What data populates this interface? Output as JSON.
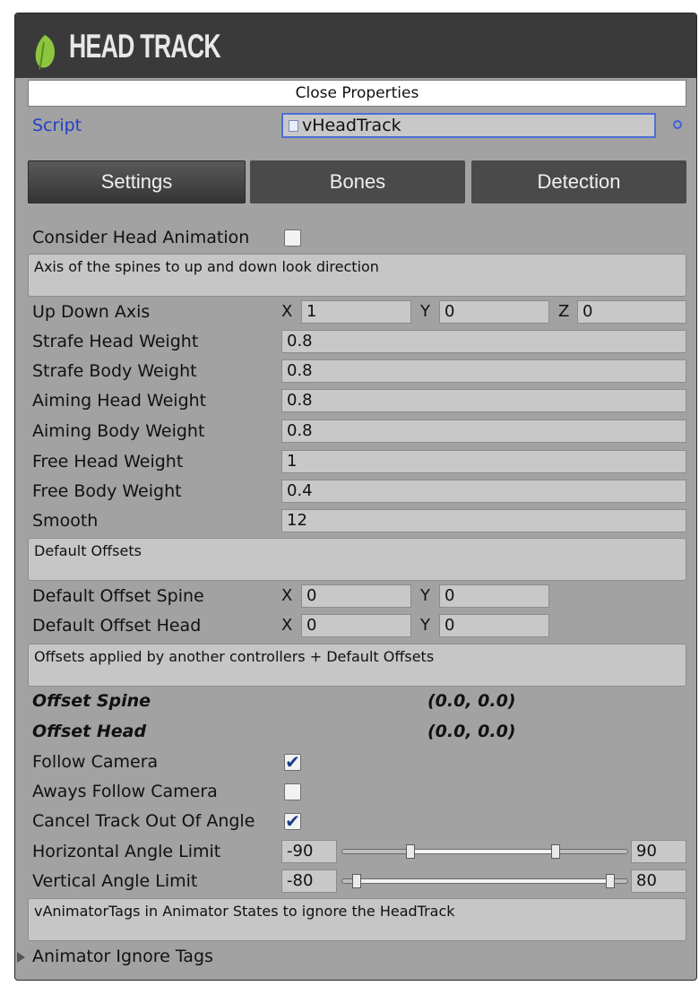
{
  "header": {
    "title": "HEAD TRACK",
    "logo_icon": "leaf-icon",
    "accent_color": "#8cc63f"
  },
  "close_properties_label": "Close Properties",
  "script": {
    "label": "Script",
    "value": "vHeadTrack"
  },
  "tabs": [
    {
      "label": "Settings",
      "active": true
    },
    {
      "label": "Bones",
      "active": false
    },
    {
      "label": "Detection",
      "active": false
    }
  ],
  "consider_head_animation": {
    "label": "Consider Head Animation",
    "checked": false
  },
  "help": {
    "axis": "Axis of the spines to up and down look direction",
    "default_offsets": "Default Offsets",
    "offsets_applied": "Offsets applied by another controllers + Default Offsets",
    "animator_tags": "vAnimatorTags in Animator States to ignore the HeadTrack"
  },
  "up_down_axis": {
    "label": "Up Down Axis",
    "x_letter": "X",
    "y_letter": "Y",
    "z_letter": "Z",
    "x": "1",
    "y": "0",
    "z": "0"
  },
  "weights": [
    {
      "label": "Strafe Head Weight",
      "value": "0.8"
    },
    {
      "label": "Strafe Body Weight",
      "value": "0.8"
    },
    {
      "label": "Aiming Head Weight",
      "value": "0.8"
    },
    {
      "label": "Aiming Body Weight",
      "value": "0.8"
    },
    {
      "label": "Free Head Weight",
      "value": "1"
    },
    {
      "label": "Free Body Weight",
      "value": "0.4"
    },
    {
      "label": "Smooth",
      "value": "12"
    }
  ],
  "default_offset_spine": {
    "label": "Default Offset Spine",
    "x_letter": "X",
    "y_letter": "Y",
    "x": "0",
    "y": "0"
  },
  "default_offset_head": {
    "label": "Default Offset Head",
    "x_letter": "X",
    "y_letter": "Y",
    "x": "0",
    "y": "0"
  },
  "offset_spine": {
    "label": "Offset Spine",
    "value": "(0.0, 0.0)"
  },
  "offset_head": {
    "label": "Offset Head",
    "value": "(0.0, 0.0)"
  },
  "follow_camera": {
    "label": "Follow Camera",
    "checked": true,
    "mark": "✔"
  },
  "always_follow_camera": {
    "label": "Aways Follow Camera",
    "checked": false,
    "mark": ""
  },
  "cancel_track": {
    "label": "Cancel Track Out Of Angle",
    "checked": true,
    "mark": "✔"
  },
  "horizontal_angle_limit": {
    "label": "Horizontal Angle Limit",
    "min": "-90",
    "max": "90"
  },
  "vertical_angle_limit": {
    "label": "Vertical Angle Limit",
    "min": "-80",
    "max": "80"
  },
  "animator_ignore_tags": {
    "label": "Animator Ignore Tags"
  }
}
